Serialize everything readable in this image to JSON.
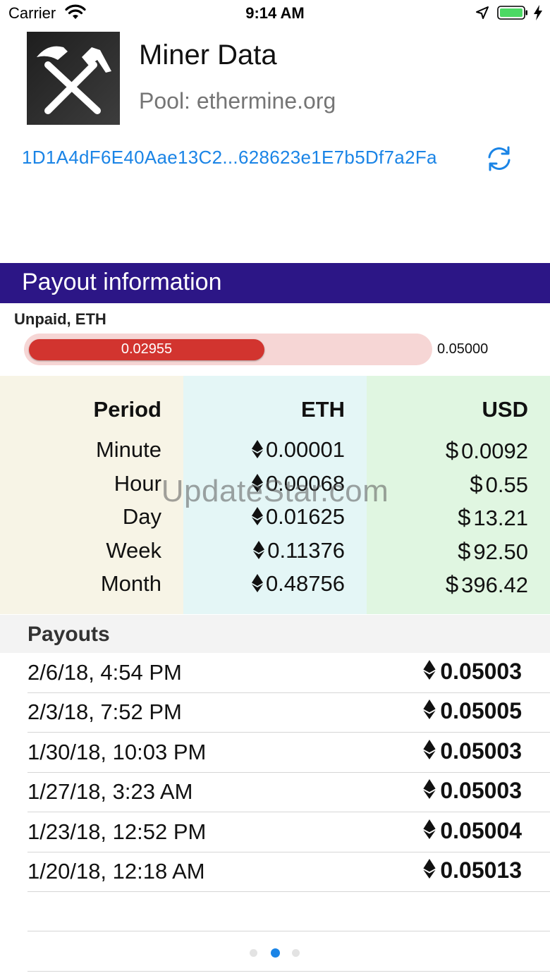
{
  "status_bar": {
    "carrier": "Carrier",
    "time": "9:14 AM"
  },
  "header": {
    "app_title": "Miner Data",
    "pool": "Pool: ethermine.org",
    "address": "1D1A4dF6E40Aae13C2...628623e1E7b5Df7a2Fa"
  },
  "payout_info": {
    "title": "Payout information",
    "unpaid_label": "Unpaid, ETH",
    "progress": {
      "current": "0.02955",
      "max": "0.05000",
      "fraction": 0.591
    }
  },
  "earnings": {
    "headers": {
      "period": "Period",
      "eth": "ETH",
      "usd": "USD"
    },
    "rows": [
      {
        "period": "Minute",
        "eth": "0.00001",
        "usd": "0.0092"
      },
      {
        "period": "Hour",
        "eth": "0.00068",
        "usd": "0.55"
      },
      {
        "period": "Day",
        "eth": "0.01625",
        "usd": "13.21"
      },
      {
        "period": "Week",
        "eth": "0.11376",
        "usd": "92.50"
      },
      {
        "period": "Month",
        "eth": "0.48756",
        "usd": "396.42"
      }
    ],
    "usd_symbol": "$"
  },
  "payouts": {
    "title": "Payouts",
    "rows": [
      {
        "date": "2/6/18, 4:54 PM",
        "amount": "0.05003"
      },
      {
        "date": "2/3/18, 7:52 PM",
        "amount": "0.05005"
      },
      {
        "date": "1/30/18, 10:03 PM",
        "amount": "0.05003"
      },
      {
        "date": "1/27/18, 3:23 AM",
        "amount": "0.05003"
      },
      {
        "date": "1/23/18, 12:52 PM",
        "amount": "0.05004"
      },
      {
        "date": "1/20/18, 12:18 AM",
        "amount": "0.05013"
      }
    ]
  },
  "pager": {
    "count": 3,
    "active_index": 1
  },
  "watermark": "UpdateStar.com",
  "colors": {
    "accent_blue": "#1a84e6",
    "section_bar": "#2c1686",
    "progress_fill": "#d2342f",
    "progress_track": "#f6d6d5"
  },
  "icons": {
    "wifi": "wifi-icon",
    "location": "location-arrow-icon",
    "battery": "battery-icon",
    "charging": "charging-bolt-icon",
    "logo": "pickaxe-hammer-icon",
    "refresh": "refresh-icon",
    "eth": "ethereum-icon"
  }
}
